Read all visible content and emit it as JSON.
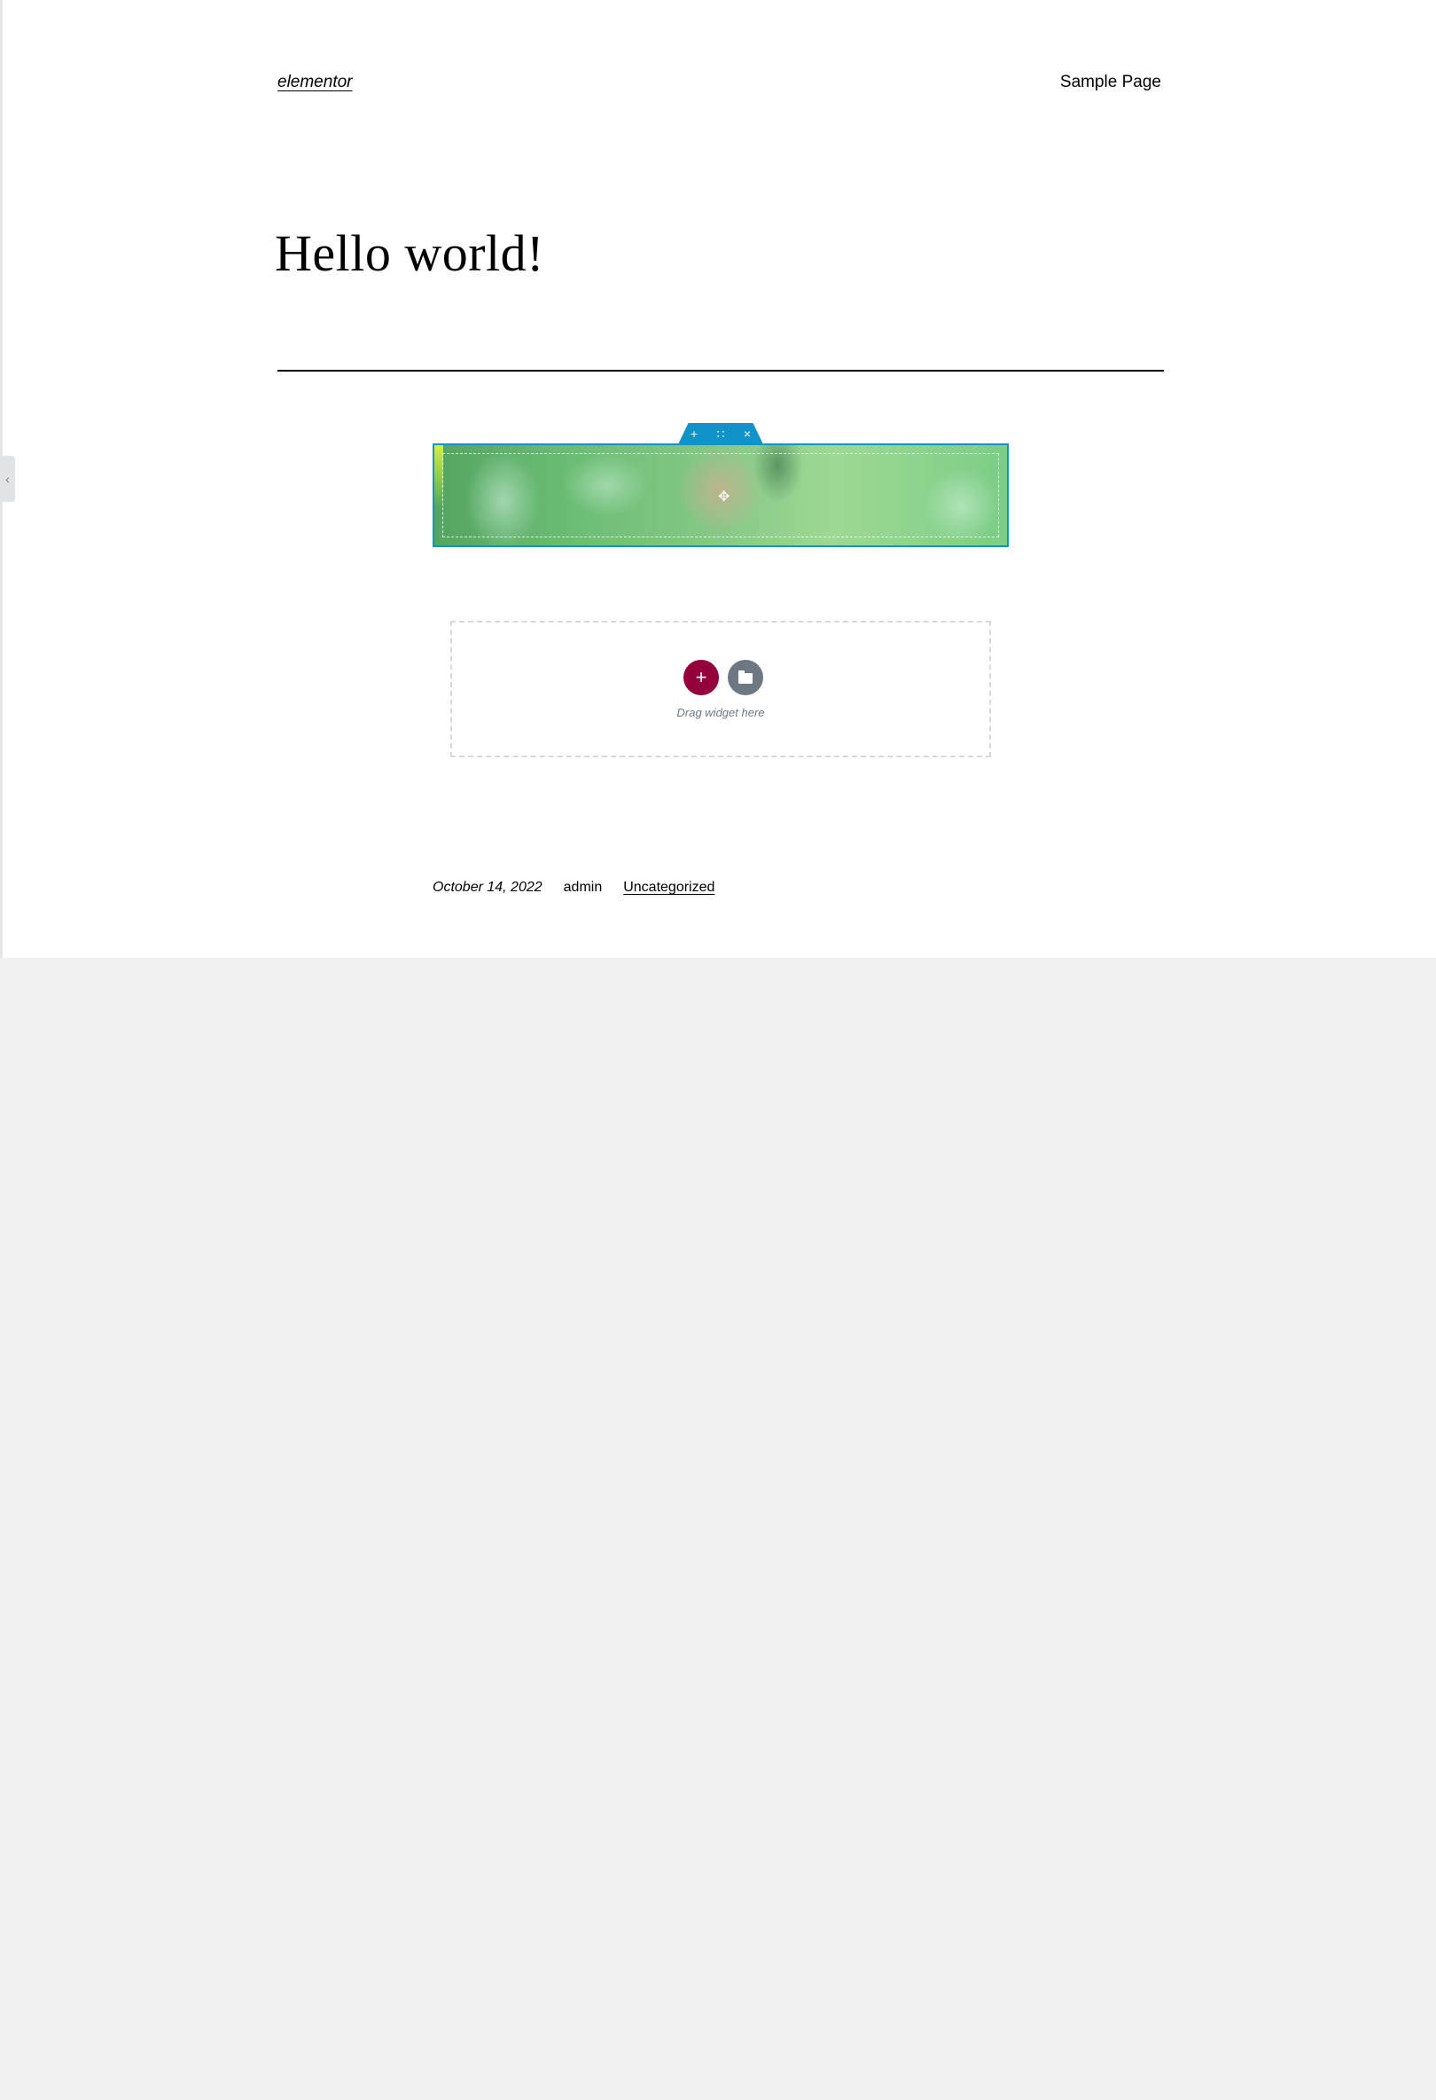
{
  "header": {
    "site_title": "elementor",
    "nav_link": "Sample Page"
  },
  "post": {
    "title": "Hello world!",
    "date": "October 14, 2022",
    "author": "admin",
    "category": "Uncategorized"
  },
  "editor": {
    "section_handle": {
      "add_icon": "+",
      "move_icon": "∷",
      "delete_icon": "×"
    },
    "panel_toggle_icon": "‹",
    "drop_zone": {
      "add_icon": "+",
      "label": "Drag widget here"
    }
  },
  "colors": {
    "editor_blue": "#0f93c9",
    "add_button": "#93003c",
    "template_button": "#6d7882"
  }
}
